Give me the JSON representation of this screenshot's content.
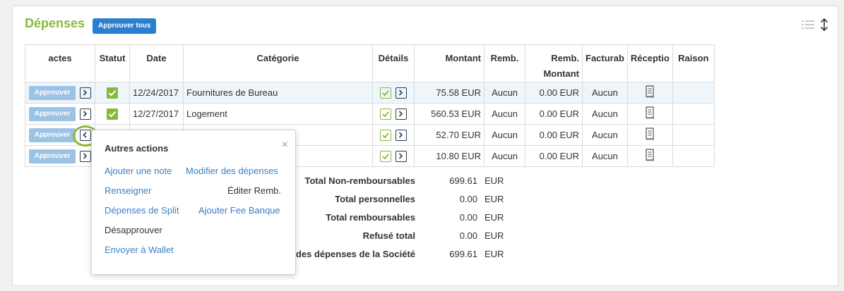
{
  "panel": {
    "title": "Dépenses",
    "approve_all_label": "Approuver tous",
    "list_icon": "list-icon",
    "sort_icon": "sort-vertical-icon"
  },
  "table": {
    "headers": {
      "actions": "actes",
      "status": "Statut",
      "date": "Date",
      "category": "Catégorie",
      "details": "Détails",
      "amount": "Montant",
      "remb": "Remb.",
      "remb_amount_1": "Remb.",
      "remb_amount_2": "Montant",
      "billable": "Facturab",
      "receipt": "Réceptio",
      "reason": "Raison"
    },
    "rows": [
      {
        "approve": "Approuver",
        "date": "12/24/2017",
        "category": "Fournitures de Bureau",
        "amount": "75.58 EUR",
        "remb": "Aucun",
        "remb_amount": "0.00 EUR",
        "billable": "Aucun",
        "reason": ""
      },
      {
        "approve": "Approuver",
        "date": "12/27/2017",
        "category": "Logement",
        "amount": "560.53 EUR",
        "remb": "Aucun",
        "remb_amount": "0.00 EUR",
        "billable": "Aucun",
        "reason": ""
      },
      {
        "approve": "Approuver",
        "date": "",
        "category": "",
        "amount": "52.70 EUR",
        "remb": "Aucun",
        "remb_amount": "0.00 EUR",
        "billable": "Aucun",
        "reason": ""
      },
      {
        "approve": "Approuver",
        "date": "",
        "category": "",
        "amount": "10.80 EUR",
        "remb": "Aucun",
        "remb_amount": "0.00 EUR",
        "billable": "Aucun",
        "reason": ""
      }
    ]
  },
  "totals": [
    {
      "label": "Total Non-remboursables",
      "value": "699.61",
      "currency": "EUR"
    },
    {
      "label": "Total personnelles",
      "value": "0.00",
      "currency": "EUR"
    },
    {
      "label": "Total remboursables",
      "value": "0.00",
      "currency": "EUR"
    },
    {
      "label": "Refusé total",
      "value": "0.00",
      "currency": "EUR"
    },
    {
      "label": "des dépenses de la Société",
      "value": "699.61",
      "currency": "EUR"
    }
  ],
  "popup": {
    "title": "Autres actions",
    "close": "×",
    "items": {
      "add_note": "Ajouter une note",
      "edit_expenses": "Modifier des dépenses",
      "fill_in": "Renseigner",
      "edit_remb": "Éditer Remb.",
      "split": "Dépenses de Split",
      "bank_fee": "Ajouter Fee Banque",
      "unapprove": "Désapprouver",
      "send_wallet": "Envoyer à Wallet"
    }
  },
  "colors": {
    "accent_green": "#8ab93a",
    "primary_blue": "#2b7fd0",
    "link_blue": "#3a7fc4",
    "approve_button": "#9ac3e6"
  }
}
